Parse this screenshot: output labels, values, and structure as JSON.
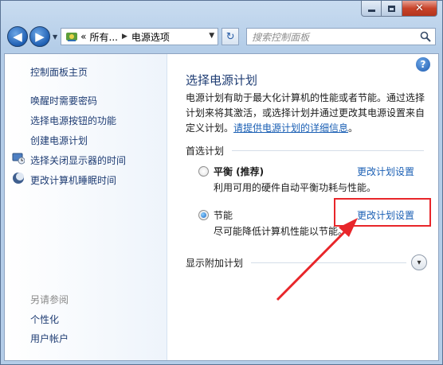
{
  "window": {
    "min_glyph": "",
    "close_glyph": "✕"
  },
  "navbar": {
    "back_glyph": "◀",
    "forward_glyph": "▶",
    "address_prefix": "«",
    "address_crumb1": "所有...",
    "address_crumb2": "电源选项",
    "refresh_glyph": "↻",
    "search_placeholder": "搜索控制面板"
  },
  "sidebar": {
    "home": "控制面板主页",
    "items": [
      "唤醒时需要密码",
      "选择电源按钮的功能",
      "创建电源计划",
      "选择关闭显示器的时间",
      "更改计算机睡眠时间"
    ],
    "see_also_label": "另请参阅",
    "see_also": [
      "个性化",
      "用户帐户"
    ]
  },
  "main": {
    "help_glyph": "?",
    "title": "选择电源计划",
    "description_line1": "电源计划有助于最大化计算机的性能或者节能。通过选择",
    "description_line2": "计划来将其激活，或选择计划并通过更改其电源设置来自",
    "description_line3_prefix": "定义计划。",
    "description_link": "请提供电源计划的详细信息",
    "description_line3_suffix": "。",
    "preferred_label": "首选计划",
    "plans": [
      {
        "name": "平衡 (推荐)",
        "desc": "利用可用的硬件自动平衡功耗与性能。",
        "link": "更改计划设置",
        "selected": false
      },
      {
        "name": "节能",
        "desc": "尽可能降低计算机性能以节能。",
        "link": "更改计划设置",
        "selected": true
      }
    ],
    "more_plans_label": "显示附加计划",
    "expand_glyph": "▾"
  },
  "colors": {
    "annotation": "#e8262a",
    "link": "#1a5fb4",
    "heading": "#1e3c73"
  }
}
